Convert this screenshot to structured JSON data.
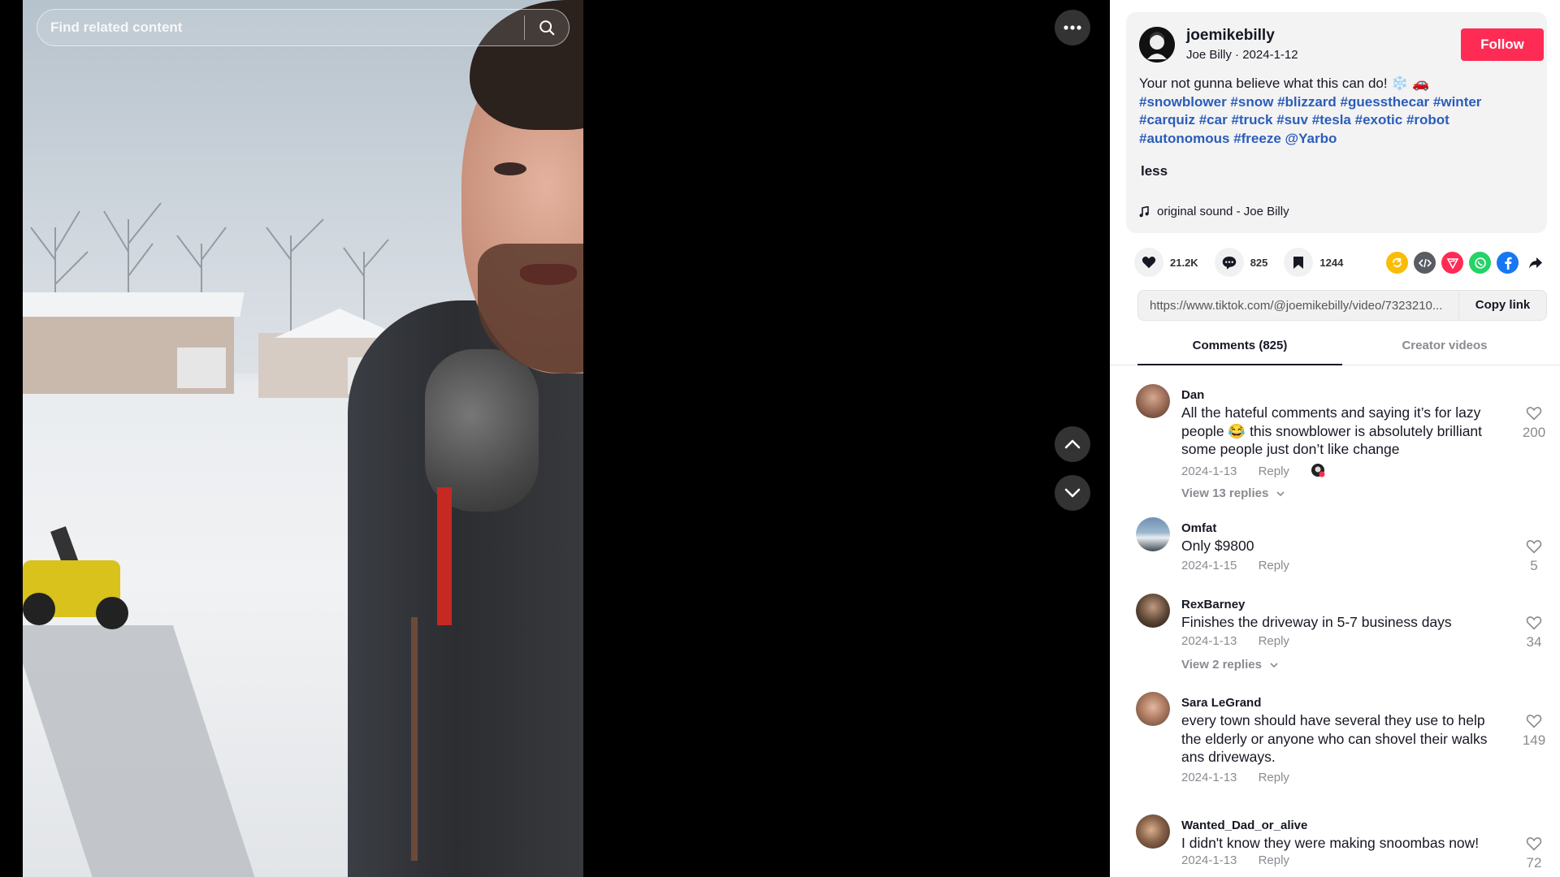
{
  "search": {
    "placeholder": "Find related content"
  },
  "author": {
    "username": "joemikebilly",
    "display_name": "Joe Billy",
    "date": "2024-1-12",
    "follow_label": "Follow"
  },
  "caption": {
    "text": "Your not gunna believe what this can do!",
    "emojis": "❄️ 🚗",
    "hashtags": [
      "#snowblower",
      "#snow",
      "#blizzard",
      "#guessthecar",
      "#winter",
      "#carquiz",
      "#car",
      "#truck",
      "#suv",
      "#tesla",
      "#exotic",
      "#robot",
      "#autonomous",
      "#freeze",
      "@Yarbo"
    ],
    "less_label": "less"
  },
  "sound": {
    "label": "original sound - Joe Billy"
  },
  "stats": {
    "likes": "21.2K",
    "comments": "825",
    "saves": "1244"
  },
  "share_icons": [
    "repost-icon",
    "embed-icon",
    "send-icon",
    "whatsapp-icon",
    "facebook-icon",
    "share-arrow-icon"
  ],
  "link": {
    "url": "https://www.tiktok.com/@joemikebilly/video/7323210...",
    "copy_label": "Copy link"
  },
  "tabs": {
    "comments": "Comments (825)",
    "creator": "Creator videos"
  },
  "comments": [
    {
      "user": "Dan",
      "text": "All the hateful comments and saying it’s for lazy people 😂 this snowblower is absolutely brilliant some people just don’t like change",
      "date": "2024-1-13",
      "reply": "Reply",
      "likes": "200",
      "replies": "View 13 replies"
    },
    {
      "user": "Omfat",
      "text": "Only $9800",
      "date": "2024-1-15",
      "reply": "Reply",
      "likes": "5",
      "replies": ""
    },
    {
      "user": "RexBarney",
      "text": "Finishes the driveway in 5-7 business days",
      "date": "2024-1-13",
      "reply": "Reply",
      "likes": "34",
      "replies": "View 2 replies"
    },
    {
      "user": "Sara LeGrand",
      "text": "every town should have several they use to help the elderly or anyone who can shovel their walks ans driveways.",
      "date": "2024-1-13",
      "reply": "Reply",
      "likes": "149",
      "replies": ""
    },
    {
      "user": "Wanted_Dad_or_alive",
      "text": "I didn't know they were making snoombas now!",
      "date": "2024-1-13",
      "reply": "Reply",
      "likes": "72",
      "replies": ""
    }
  ],
  "colors": {
    "follow": "#fe2c55",
    "hashtag": "#2b5db9",
    "muted": "#8a8b91"
  }
}
